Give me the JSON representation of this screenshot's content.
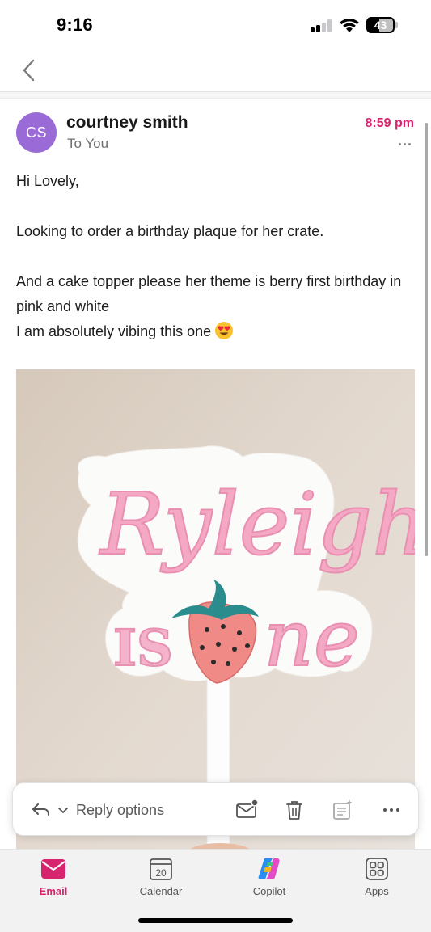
{
  "status_bar": {
    "time": "9:16",
    "battery": "43",
    "battery_level": 0.43,
    "signal_bars_active": 2,
    "signal_bars_total": 4
  },
  "nav": {
    "back_icon": "chevron-left-icon"
  },
  "message": {
    "avatar_initials": "CS",
    "avatar_color": "#9a6ad6",
    "sender": "courtney smith",
    "recipient": "To You",
    "time": "8:59 pm",
    "time_color": "#d6246e",
    "body": {
      "greeting": "Hi Lovely,",
      "line1": "Looking to order a birthday plaque for her crate.",
      "line2": "And a cake topper please her theme is berry first birthday in pink and white",
      "line3": "I am absolutely vibing this one",
      "line3_emoji": "heart-eyes-emoji"
    },
    "attachment": {
      "name_text": "Ryleigh",
      "is_text": "IS",
      "one_text": "ne"
    }
  },
  "toolbar": {
    "reply_label": "Reply options",
    "icons": [
      "reply-icon",
      "chevron-down-icon",
      "mark-unread-icon",
      "trash-icon",
      "summary-icon",
      "more-icon"
    ]
  },
  "tabs": [
    {
      "label": "Email",
      "icon": "mail-icon",
      "active": true
    },
    {
      "label": "Calendar",
      "icon": "calendar-icon",
      "date": "20",
      "active": false
    },
    {
      "label": "Copilot",
      "icon": "copilot-icon",
      "active": false
    },
    {
      "label": "Apps",
      "icon": "apps-icon",
      "active": false
    }
  ],
  "colors": {
    "accent": "#d6246e",
    "avatar": "#9a6ad6",
    "topper_pink": "#f4a8c4",
    "strawberry": "#ef8a86",
    "leaf": "#2a8c8c"
  }
}
